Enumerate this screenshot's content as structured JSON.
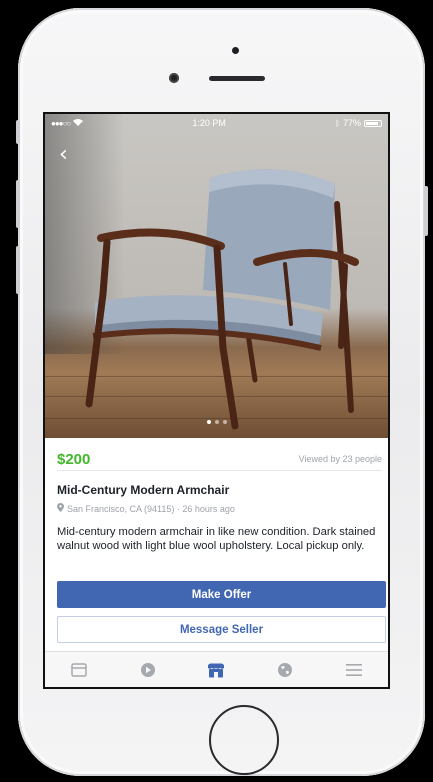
{
  "status_bar": {
    "carrier_dots": "●●●○○",
    "time": "1:20 PM",
    "battery": "77%"
  },
  "listing": {
    "price": "$200",
    "viewed": "Viewed by 23 people",
    "title": "Mid-Century Modern Armchair",
    "location": "San Francisco, CA (94115) · 26 hours ago",
    "description": "Mid-century modern armchair in like new condition. Dark stained walnut wood with light blue wool upholstery. Local pickup only.",
    "photo_count": 3,
    "photo_index": 1
  },
  "actions": {
    "make_offer": "Make Offer",
    "message_seller": "Message Seller"
  },
  "tabs": [
    {
      "icon": "news-feed-icon",
      "active": false
    },
    {
      "icon": "video-icon",
      "active": false
    },
    {
      "icon": "marketplace-icon",
      "active": true
    },
    {
      "icon": "globe-icon",
      "active": false
    },
    {
      "icon": "menu-icon",
      "active": false
    }
  ],
  "colors": {
    "price_green": "#42b72a",
    "facebook_blue": "#4267b2",
    "inactive_icon": "#a6a9ae"
  }
}
